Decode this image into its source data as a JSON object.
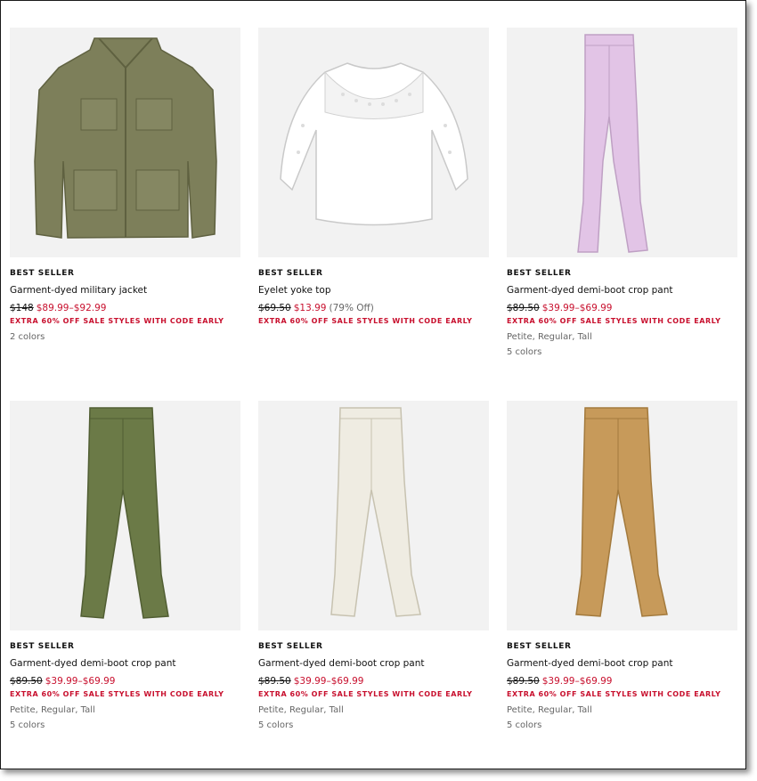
{
  "products": [
    {
      "image_icon": "military-jacket-image",
      "badge": "BEST SELLER",
      "name": "Garment-dyed military jacket",
      "original_price": "$148",
      "sale_price": "$89.99–$92.99",
      "discount": "",
      "promo": "EXTRA 60% OFF SALE STYLES WITH CODE EARLY",
      "sizes": "2 colors",
      "colors": "",
      "color": "#7d7f5a"
    },
    {
      "image_icon": "eyelet-top-image",
      "badge": "BEST SELLER",
      "name": "Eyelet yoke top",
      "original_price": "$69.50",
      "sale_price": "$13.99",
      "discount": "(79% Off)",
      "promo": "EXTRA 60% OFF SALE STYLES WITH CODE EARLY",
      "sizes": "",
      "colors": "",
      "color": "#ffffff"
    },
    {
      "image_icon": "pink-pant-image",
      "badge": "BEST SELLER",
      "name": "Garment-dyed demi-boot crop pant",
      "original_price": "$89.50",
      "sale_price": "$39.99–$69.99",
      "discount": "",
      "promo": "EXTRA 60% OFF SALE STYLES WITH CODE EARLY",
      "sizes": "Petite, Regular, Tall",
      "colors": "5 colors",
      "color": "#e2c4e6"
    },
    {
      "image_icon": "green-pant-image",
      "badge": "BEST SELLER",
      "name": "Garment-dyed demi-boot crop pant",
      "original_price": "$89.50",
      "sale_price": "$39.99–$69.99",
      "discount": "",
      "promo": "EXTRA 60% OFF SALE STYLES WITH CODE EARLY",
      "sizes": "Petite, Regular, Tall",
      "colors": "5 colors",
      "color": "#6b7a47"
    },
    {
      "image_icon": "ivory-pant-image",
      "badge": "BEST SELLER",
      "name": "Garment-dyed demi-boot crop pant",
      "original_price": "$89.50",
      "sale_price": "$39.99–$69.99",
      "discount": "",
      "promo": "EXTRA 60% OFF SALE STYLES WITH CODE EARLY",
      "sizes": "Petite, Regular, Tall",
      "colors": "5 colors",
      "color": "#efece2"
    },
    {
      "image_icon": "tan-pant-image",
      "badge": "BEST SELLER",
      "name": "Garment-dyed demi-boot crop pant",
      "original_price": "$89.50",
      "sale_price": "$39.99–$69.99",
      "discount": "",
      "promo": "EXTRA 60% OFF SALE STYLES WITH CODE EARLY",
      "sizes": "Petite, Regular, Tall",
      "colors": "5 colors",
      "color": "#c79a5a"
    }
  ]
}
